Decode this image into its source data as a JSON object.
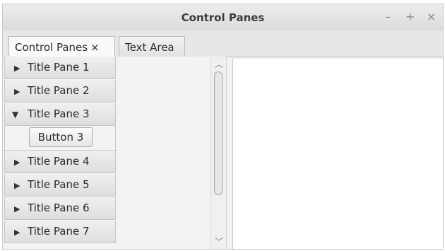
{
  "window": {
    "title": "Control Panes",
    "controls": {
      "minimize": "–",
      "maximize": "+",
      "close": "×"
    }
  },
  "tabs": [
    {
      "label": "Control Panes",
      "close": "×",
      "active": true
    },
    {
      "label": "Text Area",
      "active": false
    }
  ],
  "accordion": {
    "panes": [
      {
        "label": "Title Pane 1",
        "expanded": false
      },
      {
        "label": "Title Pane 2",
        "expanded": false
      },
      {
        "label": "Title Pane 3",
        "expanded": true
      },
      {
        "label": "Title Pane 4",
        "expanded": false
      },
      {
        "label": "Title Pane 5",
        "expanded": false
      },
      {
        "label": "Title Pane 6",
        "expanded": false
      },
      {
        "label": "Title Pane 7",
        "expanded": false
      }
    ],
    "expanded_button": "Button 3",
    "icons": {
      "collapsed": "triangle-right-icon",
      "expanded": "triangle-down-icon"
    }
  },
  "scrollbar": {
    "up_icon": "chevron-up-icon",
    "down_icon": "chevron-down-icon"
  },
  "textarea": {
    "value": ""
  }
}
